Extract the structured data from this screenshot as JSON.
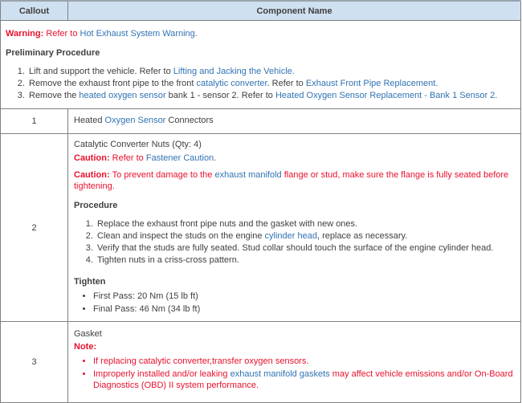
{
  "colors": {
    "link_blue": "#3173b4",
    "warning_red": "#e8112d",
    "header_background": "#cfe0f0",
    "table_border": "#808080",
    "body_text": "#3f3f3f"
  },
  "header": {
    "callout_label": "Callout",
    "component_label": "Component Name"
  },
  "preliminary": {
    "warning": [
      {
        "t": "Warning: ",
        "s": "rb"
      },
      {
        "t": "Refer to ",
        "s": "r"
      },
      {
        "t": "Hot Exhaust System Warning",
        "s": "l"
      },
      {
        "t": ".",
        "s": "r"
      }
    ],
    "title": "Preliminary Procedure",
    "steps": [
      [
        {
          "t": "Lift and support the vehicle. Refer to ",
          "s": "p"
        },
        {
          "t": "Lifting and Jacking the Vehicle.",
          "s": "l"
        }
      ],
      [
        {
          "t": "Remove the exhaust front pipe to the front ",
          "s": "p"
        },
        {
          "t": "catalytic converter",
          "s": "l"
        },
        {
          "t": ". Refer to ",
          "s": "p"
        },
        {
          "t": "Exhaust Front Pipe Replacement.",
          "s": "l"
        }
      ],
      [
        {
          "t": "Remove the ",
          "s": "p"
        },
        {
          "t": "heated oxygen sensor",
          "s": "l"
        },
        {
          "t": " bank 1 - sensor 2. Refer to ",
          "s": "p"
        },
        {
          "t": "Heated Oxygen Sensor Replacement - Bank 1 Sensor 2.",
          "s": "l"
        }
      ]
    ]
  },
  "row1": {
    "callout": "1",
    "name": [
      {
        "t": "Heated ",
        "s": "p"
      },
      {
        "t": "Oxygen Sensor",
        "s": "l"
      },
      {
        "t": " Connectors",
        "s": "p"
      }
    ]
  },
  "row2": {
    "callout": "2",
    "title": "Catalytic Converter Nuts (Qty: 4)",
    "caution1": [
      {
        "t": "Caution: ",
        "s": "rb"
      },
      {
        "t": "Refer to ",
        "s": "r"
      },
      {
        "t": "Fastener Caution",
        "s": "l"
      },
      {
        "t": ".",
        "s": "r"
      }
    ],
    "caution2": [
      {
        "t": "Caution: ",
        "s": "rb"
      },
      {
        "t": "To prevent damage to the ",
        "s": "r"
      },
      {
        "t": "exhaust manifold",
        "s": "l"
      },
      {
        "t": " flange or stud, make sure the flange is fully seated before tightening.",
        "s": "r"
      }
    ],
    "procedure_label": "Procedure",
    "steps": [
      [
        {
          "t": "Replace the exhaust front pipe nuts and the gasket with new ones.",
          "s": "p"
        }
      ],
      [
        {
          "t": "Clean and inspect the studs on the engine ",
          "s": "p"
        },
        {
          "t": "cylinder head",
          "s": "l"
        },
        {
          "t": ", replace as necessary.",
          "s": "p"
        }
      ],
      [
        {
          "t": "Verify that the studs are fully seated. Stud collar should touch the surface of the engine cylinder head.",
          "s": "p"
        }
      ],
      [
        {
          "t": "Tighten nuts in a criss-cross pattern.",
          "s": "p"
        }
      ]
    ],
    "tighten_label": "Tighten",
    "tighten_specs": [
      "First Pass: 20 Nm (15 lb ft)",
      "Final Pass: 46 Nm (34 lb ft)"
    ]
  },
  "row3": {
    "callout": "3",
    "title": "Gasket",
    "note_label": "Note:",
    "notes": [
      [
        {
          "t": "If replacing catalytic converter,transfer oxygen sensors.",
          "s": "r"
        }
      ],
      [
        {
          "t": "Improperly installed and/or leaking ",
          "s": "r"
        },
        {
          "t": "exhaust manifold gaskets",
          "s": "l"
        },
        {
          "t": " may affect vehicle emissions and/or On-Board Diagnostics (OBD) II system performance.",
          "s": "r"
        }
      ]
    ]
  }
}
